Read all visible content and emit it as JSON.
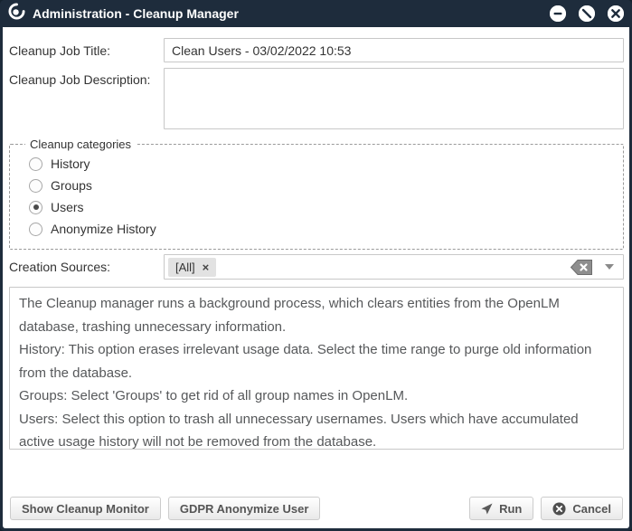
{
  "window": {
    "title": "Administration - Cleanup Manager",
    "controls": {
      "minimize": "minimize",
      "disable": "disable",
      "close": "close"
    }
  },
  "form": {
    "job_title": {
      "label": "Cleanup Job Title:",
      "value": "Clean Users - 03/02/2022 10:53"
    },
    "job_description": {
      "label": "Cleanup Job Description:",
      "value": ""
    },
    "categories": {
      "legend": "Cleanup categories",
      "options": [
        {
          "label": "History",
          "selected": false
        },
        {
          "label": "Groups",
          "selected": false
        },
        {
          "label": "Users",
          "selected": true
        },
        {
          "label": "Anonymize History",
          "selected": false
        }
      ]
    },
    "creation_sources": {
      "label": "Creation Sources:",
      "selected_chip": "[All]",
      "chip_remove": "×"
    }
  },
  "info": {
    "paragraphs": [
      "The Cleanup manager runs a background process, which clears entities from the OpenLM database, trashing unnecessary information.",
      "History: This option erases irrelevant usage data. Select the time range to purge old information from the database.",
      "Groups: Select 'Groups' to get rid of all group names in OpenLM.",
      "Users: Select this option to trash all unnecessary usernames. Users which have accumulated active usage history will not be removed from the database."
    ]
  },
  "footer": {
    "show_cleanup_monitor": "Show Cleanup Monitor",
    "gdpr_anonymize_user": "GDPR Anonymize User",
    "run": "Run",
    "cancel": "Cancel"
  },
  "colors": {
    "titlebar_bg": "#1e2c3c",
    "content_bg": "#ffffff",
    "input_border": "#c8c8c8",
    "info_text": "#56585a",
    "button_text": "#555555",
    "chip_bg": "#e2e2e2"
  }
}
